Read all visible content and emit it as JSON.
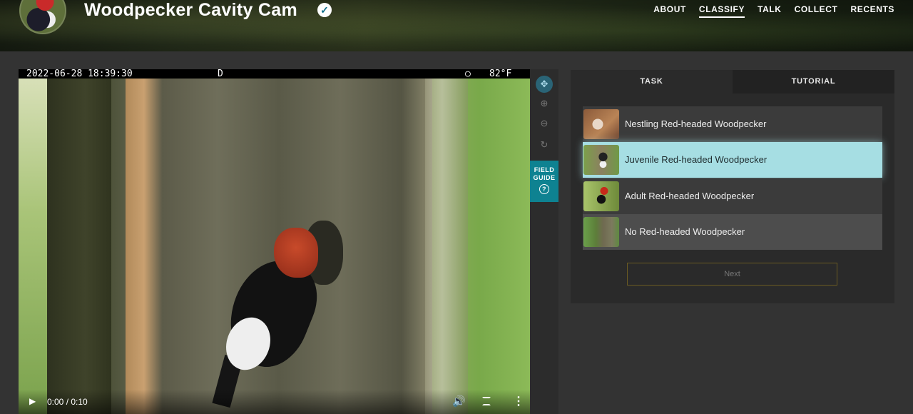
{
  "header": {
    "title": "Woodpecker Cavity Cam",
    "verified_icon": "check-badge-icon",
    "nav": [
      {
        "label": "ABOUT",
        "active": false
      },
      {
        "label": "CLASSIFY",
        "active": true
      },
      {
        "label": "TALK",
        "active": false
      },
      {
        "label": "COLLECT",
        "active": false
      },
      {
        "label": "RECENTS",
        "active": false
      }
    ]
  },
  "video": {
    "osd_datetime": "2022-06-28 18:39:30",
    "osd_mode": "D",
    "osd_symbol": "○",
    "osd_temp": "82°F",
    "time": "0:00 / 0:10",
    "play_icon": "play-icon",
    "volume_icon": "volume-icon",
    "fullscreen_icon": "fullscreen-icon",
    "more_icon": "more-vertical-icon"
  },
  "tools": {
    "move_icon": "move-icon",
    "zoom_in_icon": "zoom-in-icon",
    "zoom_out_icon": "zoom-out-icon",
    "rotate_icon": "rotate-icon",
    "field_guide_line1": "FIELD",
    "field_guide_line2": "GUIDE",
    "field_guide_icon": "?"
  },
  "panel": {
    "tabs": [
      {
        "label": "TASK",
        "active": true
      },
      {
        "label": "TUTORIAL",
        "active": false
      }
    ],
    "answers": [
      {
        "label": "Nestling Red-headed Woodpecker",
        "selected": false
      },
      {
        "label": "Juvenile Red-headed Woodpecker",
        "selected": true
      },
      {
        "label": "Adult Red-headed Woodpecker",
        "selected": false
      },
      {
        "label": "No Red-headed Woodpecker",
        "selected": false
      }
    ],
    "next_label": "Next"
  },
  "colors": {
    "selected_answer": "#a6dee3",
    "field_guide": "#0e8291",
    "background": "#333333"
  }
}
